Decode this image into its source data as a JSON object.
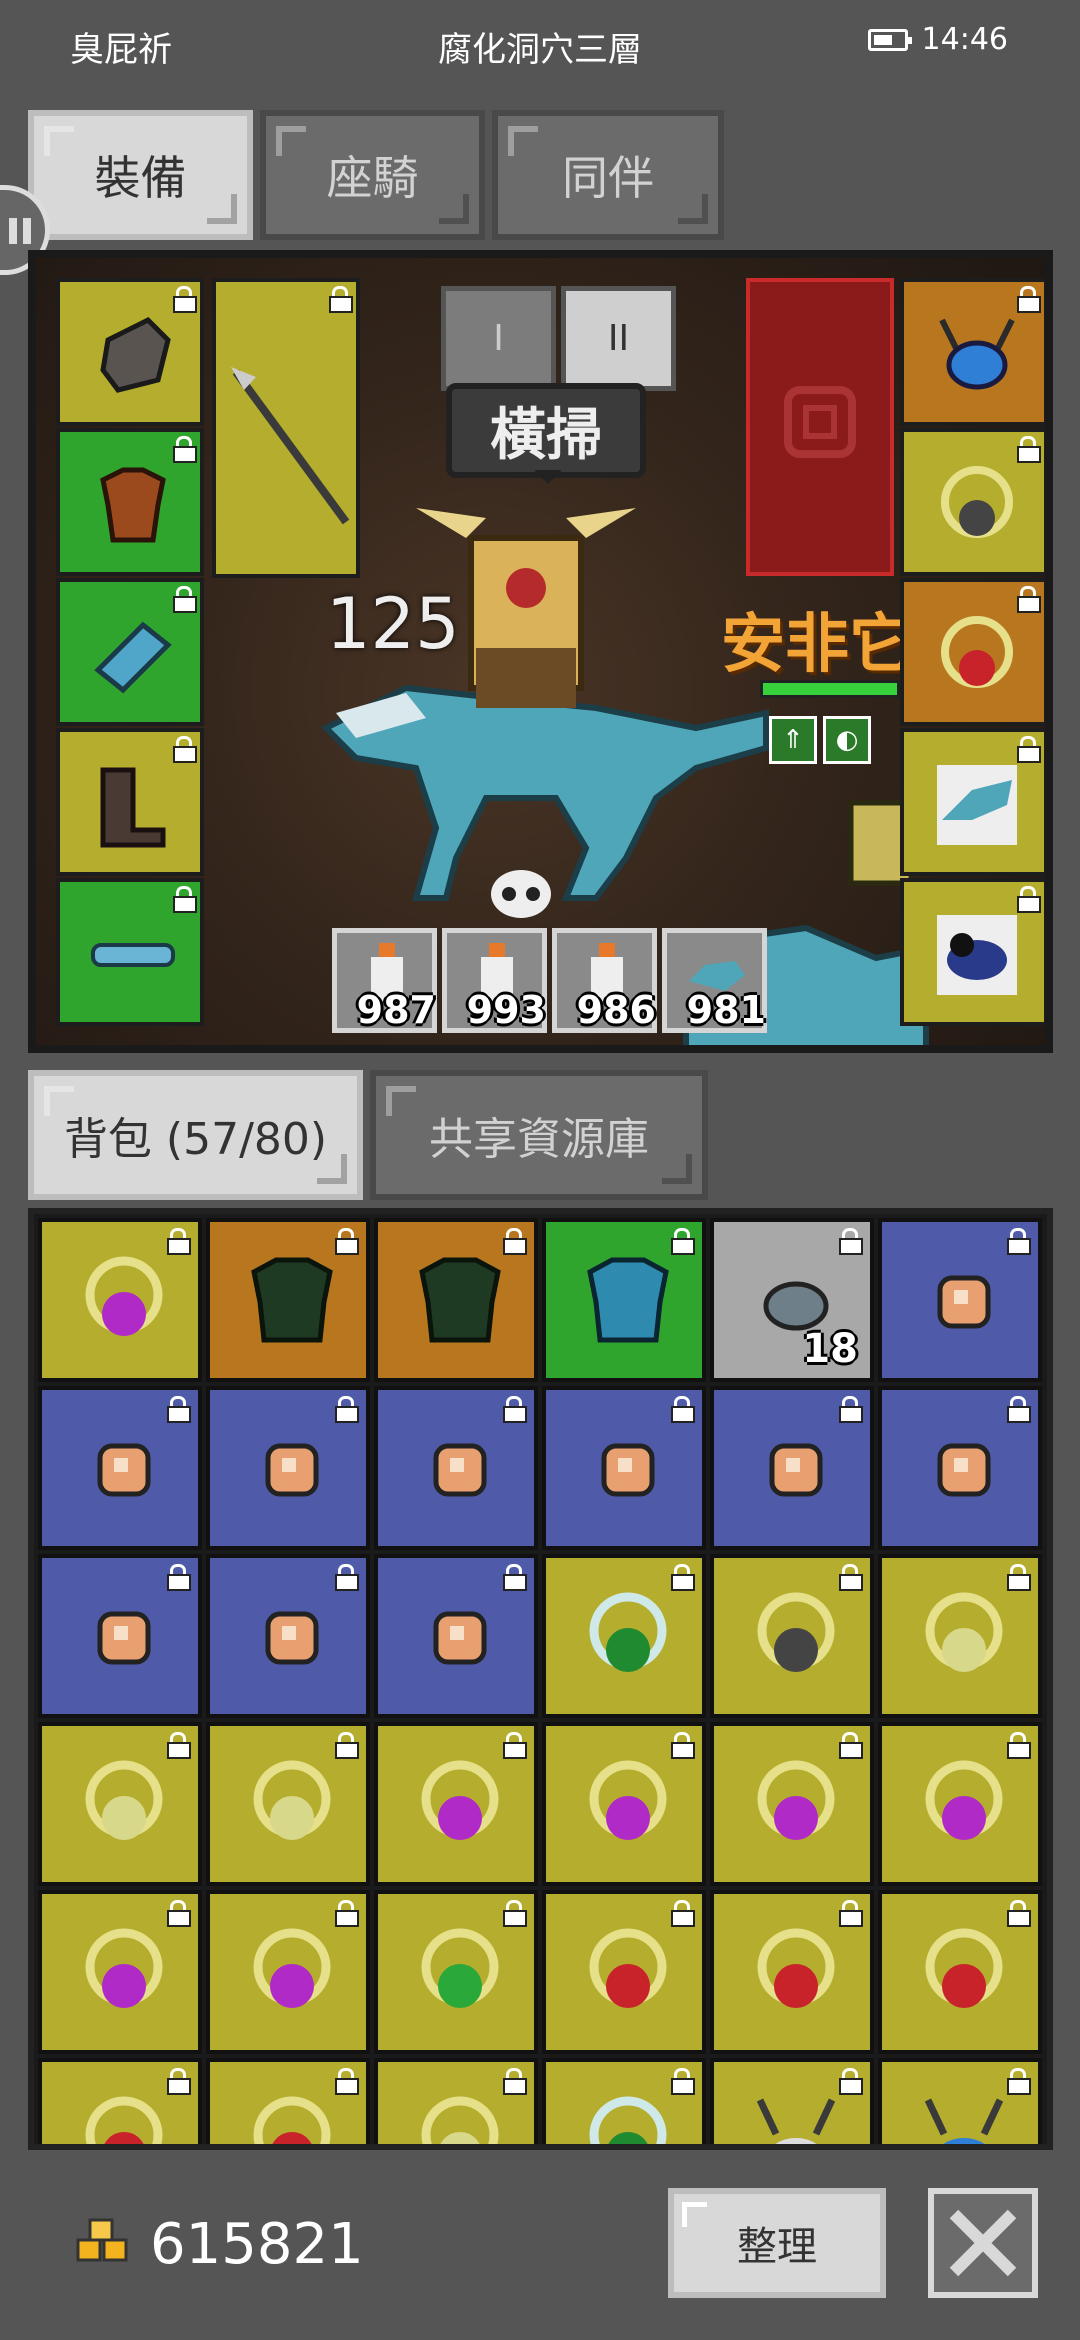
{
  "status": {
    "left": "臭屁祈",
    "title": "腐化洞穴三層",
    "time": "14:46"
  },
  "tabs": [
    "裝備",
    "座騎",
    "同伴"
  ],
  "skill_tabs": [
    "I",
    "II"
  ],
  "scene": {
    "bubble": "橫掃",
    "damage": "125",
    "enemy_name": "安非它"
  },
  "potions": [
    "987",
    "993",
    "986",
    "981"
  ],
  "bag_tabs": [
    "背包 (57/80)",
    "共享資源庫"
  ],
  "bag_items": [
    {
      "bg": "yellow",
      "icon": "amulet-purple"
    },
    {
      "bg": "orange",
      "icon": "dark-armor"
    },
    {
      "bg": "orange",
      "icon": "dark-armor"
    },
    {
      "bg": "green",
      "icon": "teal-armor"
    },
    {
      "bg": "gray",
      "icon": "ore",
      "qty": "18"
    },
    {
      "bg": "blue",
      "icon": "meat"
    },
    {
      "bg": "blue",
      "icon": "meat"
    },
    {
      "bg": "blue",
      "icon": "meat"
    },
    {
      "bg": "blue",
      "icon": "meat"
    },
    {
      "bg": "blue",
      "icon": "meat"
    },
    {
      "bg": "blue",
      "icon": "meat"
    },
    {
      "bg": "blue",
      "icon": "meat"
    },
    {
      "bg": "blue",
      "icon": "meat"
    },
    {
      "bg": "blue",
      "icon": "meat"
    },
    {
      "bg": "blue",
      "icon": "meat"
    },
    {
      "bg": "yellow",
      "icon": "amulet-green-silver"
    },
    {
      "bg": "yellow",
      "icon": "amulet-black"
    },
    {
      "bg": "yellow",
      "icon": "amulet-pale"
    },
    {
      "bg": "yellow",
      "icon": "amulet-pale"
    },
    {
      "bg": "yellow",
      "icon": "amulet-pale"
    },
    {
      "bg": "yellow",
      "icon": "amulet-purple"
    },
    {
      "bg": "yellow",
      "icon": "amulet-purple"
    },
    {
      "bg": "yellow",
      "icon": "amulet-purple"
    },
    {
      "bg": "yellow",
      "icon": "amulet-purple"
    },
    {
      "bg": "yellow",
      "icon": "amulet-purple"
    },
    {
      "bg": "yellow",
      "icon": "amulet-purple"
    },
    {
      "bg": "yellow",
      "icon": "amulet-green"
    },
    {
      "bg": "yellow",
      "icon": "amulet-red"
    },
    {
      "bg": "yellow",
      "icon": "amulet-red"
    },
    {
      "bg": "yellow",
      "icon": "amulet-red"
    },
    {
      "bg": "yellow",
      "icon": "amulet-red"
    },
    {
      "bg": "yellow",
      "icon": "amulet-red"
    },
    {
      "bg": "yellow",
      "icon": "amulet-pale"
    },
    {
      "bg": "yellow",
      "icon": "amulet-green-silver"
    },
    {
      "bg": "yellow",
      "icon": "horned-helm"
    },
    {
      "bg": "yellow",
      "icon": "horned-helm-blue"
    }
  ],
  "gold": "615821",
  "sort_label": "整理",
  "colors": {
    "yellow": "#b5ad2e",
    "green": "#2fa52d",
    "orange": "#b8771f",
    "blue": "#4f5ba9",
    "gray": "#a8a8a8"
  }
}
